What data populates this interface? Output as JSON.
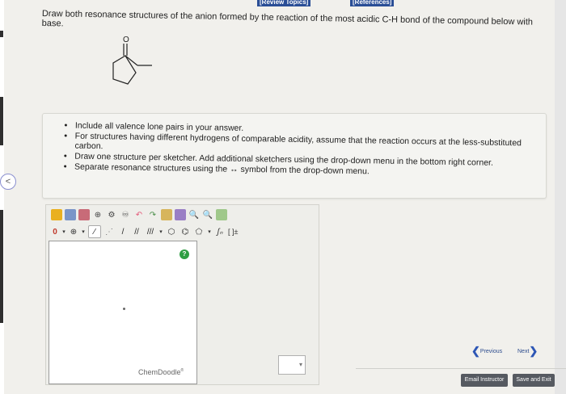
{
  "header": {
    "review_topics": "[Review Topics]",
    "references": "[References]"
  },
  "question": {
    "text": "Draw both resonance structures of the anion formed by the reaction of the most acidic C-H bond of the compound below with base."
  },
  "molecule": {
    "atom_label": "O",
    "name": "cyclopentyl methyl ketone skeleton"
  },
  "instructions": {
    "items": [
      "Include all valence lone pairs in your answer.",
      "For structures having different hydrogens of comparable acidity, assume that the reaction occurs at the less-substituted carbon.",
      "Draw one structure per sketcher. Add additional sketchers using the drop-down menu in the bottom right corner.",
      "Separate resonance structures using the ↔ symbol from the drop-down menu."
    ]
  },
  "sketcher": {
    "charge_value": "0",
    "plus_label": "⊕",
    "brackets_label": "[ ]±",
    "help_label": "?",
    "brand": "ChemDoodle",
    "brand_mark": "®"
  },
  "navigation": {
    "left_arrow": "<",
    "previous": "Previous",
    "next": "Next"
  },
  "actions": {
    "email_instructor": "Email Instructor",
    "save_and_exit": "Save and Exit"
  },
  "colors": {
    "accent_blue": "#2a4e96",
    "help_green": "#2f9e43",
    "button_gray": "#565a61"
  }
}
